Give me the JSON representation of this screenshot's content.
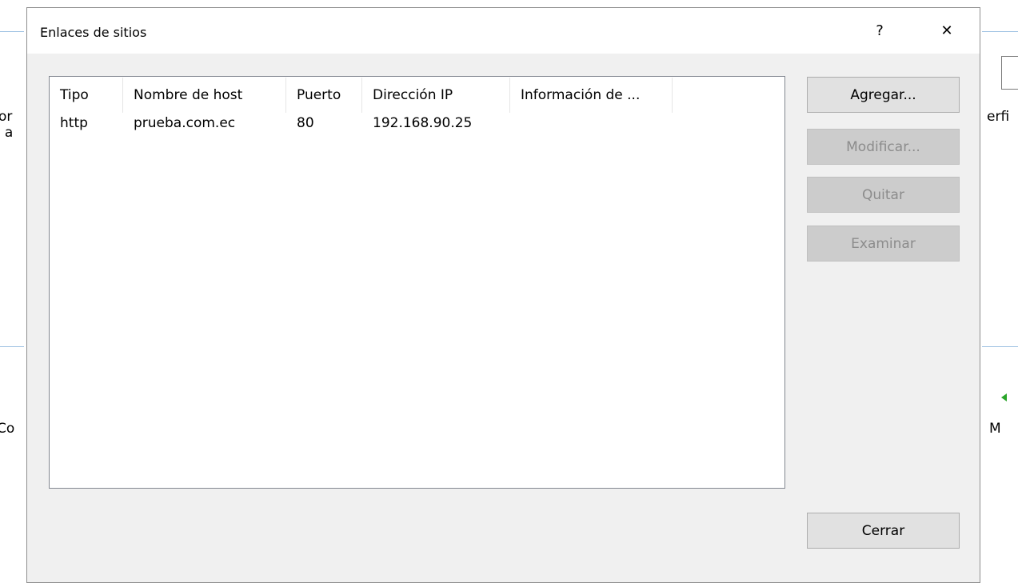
{
  "background": {
    "left_texts": [
      "or",
      "e a",
      "Co"
    ],
    "right_texts": [
      "erfi",
      "M"
    ]
  },
  "dialog": {
    "title": "Enlaces de sitios",
    "help_label": "?",
    "close_label": "✕"
  },
  "bindings_table": {
    "columns": [
      "Tipo",
      "Nombre de host",
      "Puerto",
      "Dirección IP",
      "Información de ..."
    ],
    "rows": [
      [
        "http",
        "prueba.com.ec",
        "80",
        "192.168.90.25",
        ""
      ]
    ]
  },
  "buttons": {
    "add": "Agregar...",
    "modify": "Modificar...",
    "remove": "Quitar",
    "browse": "Examinar",
    "close": "Cerrar"
  },
  "colors": {
    "dialog_bg": "#f0f0f0",
    "button_bg": "#e1e1e1",
    "button_disabled_text": "#8c8c8c",
    "accent_line": "#9fc2e3"
  }
}
